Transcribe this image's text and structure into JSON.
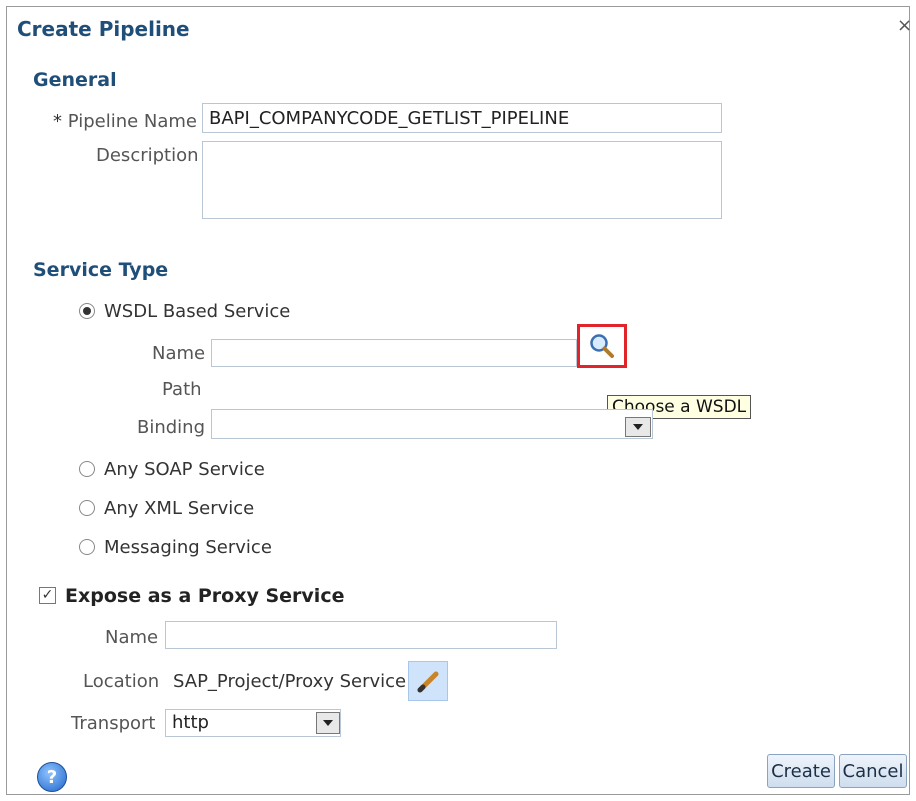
{
  "dialog": {
    "title": "Create Pipeline",
    "close_glyph": "×"
  },
  "general": {
    "heading": "General",
    "required_marker": "*",
    "pipeline_name_label": "Pipeline Name",
    "pipeline_name_value": "BAPI_COMPANYCODE_GETLIST_PIPELINE",
    "description_label": "Description",
    "description_value": ""
  },
  "service_type": {
    "heading": "Service Type",
    "options": [
      {
        "label": "WSDL Based Service",
        "selected": true
      },
      {
        "label": "Any SOAP Service",
        "selected": false
      },
      {
        "label": "Any XML Service",
        "selected": false
      },
      {
        "label": "Messaging Service",
        "selected": false
      }
    ],
    "name_label": "Name",
    "name_value": "",
    "path_label": "Path",
    "binding_label": "Binding",
    "binding_value": "",
    "search_icon": "magnifier-icon",
    "tooltip": "Choose a WSDL"
  },
  "proxy": {
    "checkbox_label": "Expose as a Proxy Service",
    "checked": true,
    "name_label": "Name",
    "name_value": "",
    "location_label": "Location",
    "location_value": "SAP_Project/Proxy Service",
    "edit_icon": "pencil-icon",
    "transport_label": "Transport",
    "transport_value": "http"
  },
  "footer": {
    "help_glyph": "?",
    "create_label": "Create",
    "cancel_label": "Cancel"
  },
  "colors": {
    "heading": "#1f4e79",
    "highlight": "#e0242a",
    "tooltip_bg": "#ffffe1"
  }
}
